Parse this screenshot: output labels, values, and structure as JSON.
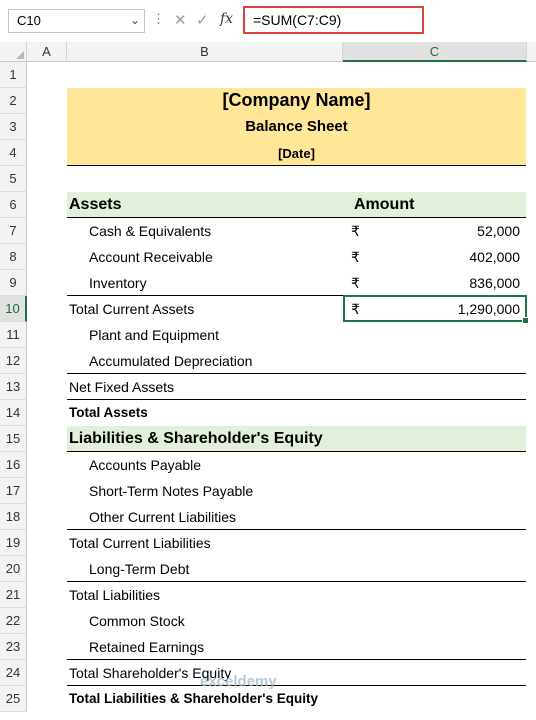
{
  "name_box": "C10",
  "formula": "=SUM(C7:C9)",
  "columns": [
    "A",
    "B",
    "C"
  ],
  "rows": [
    "1",
    "2",
    "3",
    "4",
    "5",
    "6",
    "7",
    "8",
    "9",
    "10",
    "11",
    "12",
    "13",
    "14",
    "15",
    "16",
    "17",
    "18",
    "19",
    "20",
    "21",
    "22",
    "23",
    "24",
    "25"
  ],
  "header": {
    "company": "[Company Name]",
    "title": "Balance Sheet",
    "date": "[Date]"
  },
  "assets_section": {
    "label": "Assets",
    "amount_label": "Amount"
  },
  "currency": "₹",
  "assets": [
    {
      "label": "Cash & Equivalents",
      "amount": "52,000"
    },
    {
      "label": "Account Receivable",
      "amount": "402,000"
    },
    {
      "label": "Inventory",
      "amount": "836,000"
    }
  ],
  "total_current_assets": {
    "label": "Total Current Assets",
    "amount": "1,290,000"
  },
  "fixed_assets": [
    "Plant and Equipment",
    "Accumulated Depreciation"
  ],
  "net_fixed_assets": "Net Fixed Assets",
  "total_assets": "Total Assets",
  "liabilities_section": "Liabilities & Shareholder's Equity",
  "current_liabilities": [
    "Accounts Payable",
    "Short-Term Notes Payable",
    "Other Current Liabilities"
  ],
  "total_current_liabilities": "Total Current Liabilities",
  "long_term_debt": "Long-Term Debt",
  "total_liabilities": "Total Liabilities",
  "equity": [
    "Common Stock",
    "Retained Earnings"
  ],
  "total_equity": "Total Shareholder's Equity",
  "total_liab_equity": "Total Liabilities & Shareholder's Equity",
  "watermark": "exceldemy"
}
